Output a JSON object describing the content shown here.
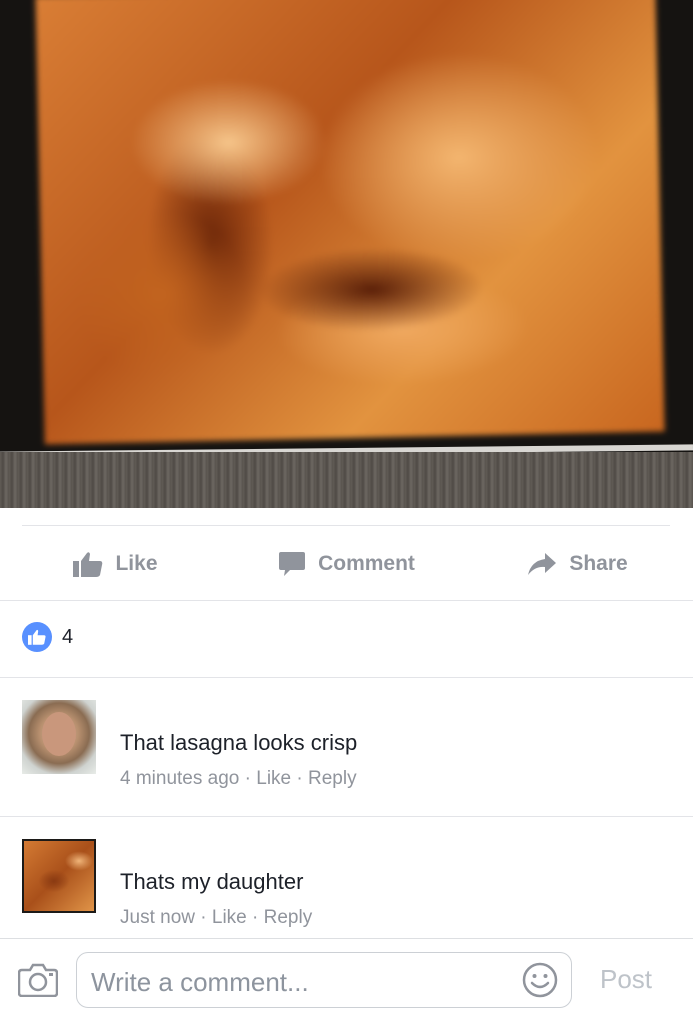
{
  "actions": {
    "like_label": "Like",
    "comment_label": "Comment",
    "share_label": "Share"
  },
  "reactions": {
    "count": "4"
  },
  "comments": [
    {
      "text": "That lasagna looks crisp",
      "time": "4 minutes ago",
      "like_label": "Like",
      "reply_label": "Reply"
    },
    {
      "text": "Thats my daughter",
      "time": "Just now",
      "like_label": "Like",
      "reply_label": "Reply"
    }
  ],
  "composer": {
    "placeholder": "Write a comment...",
    "post_label": "Post"
  },
  "icons": {
    "like": "thumbs-up-icon",
    "comment": "speech-bubble-icon",
    "share": "share-arrow-icon",
    "camera": "camera-icon",
    "emoji": "smiley-icon"
  },
  "colors": {
    "like_blue": "#5890ff",
    "muted_text": "#90949c",
    "text": "#1d2129"
  }
}
